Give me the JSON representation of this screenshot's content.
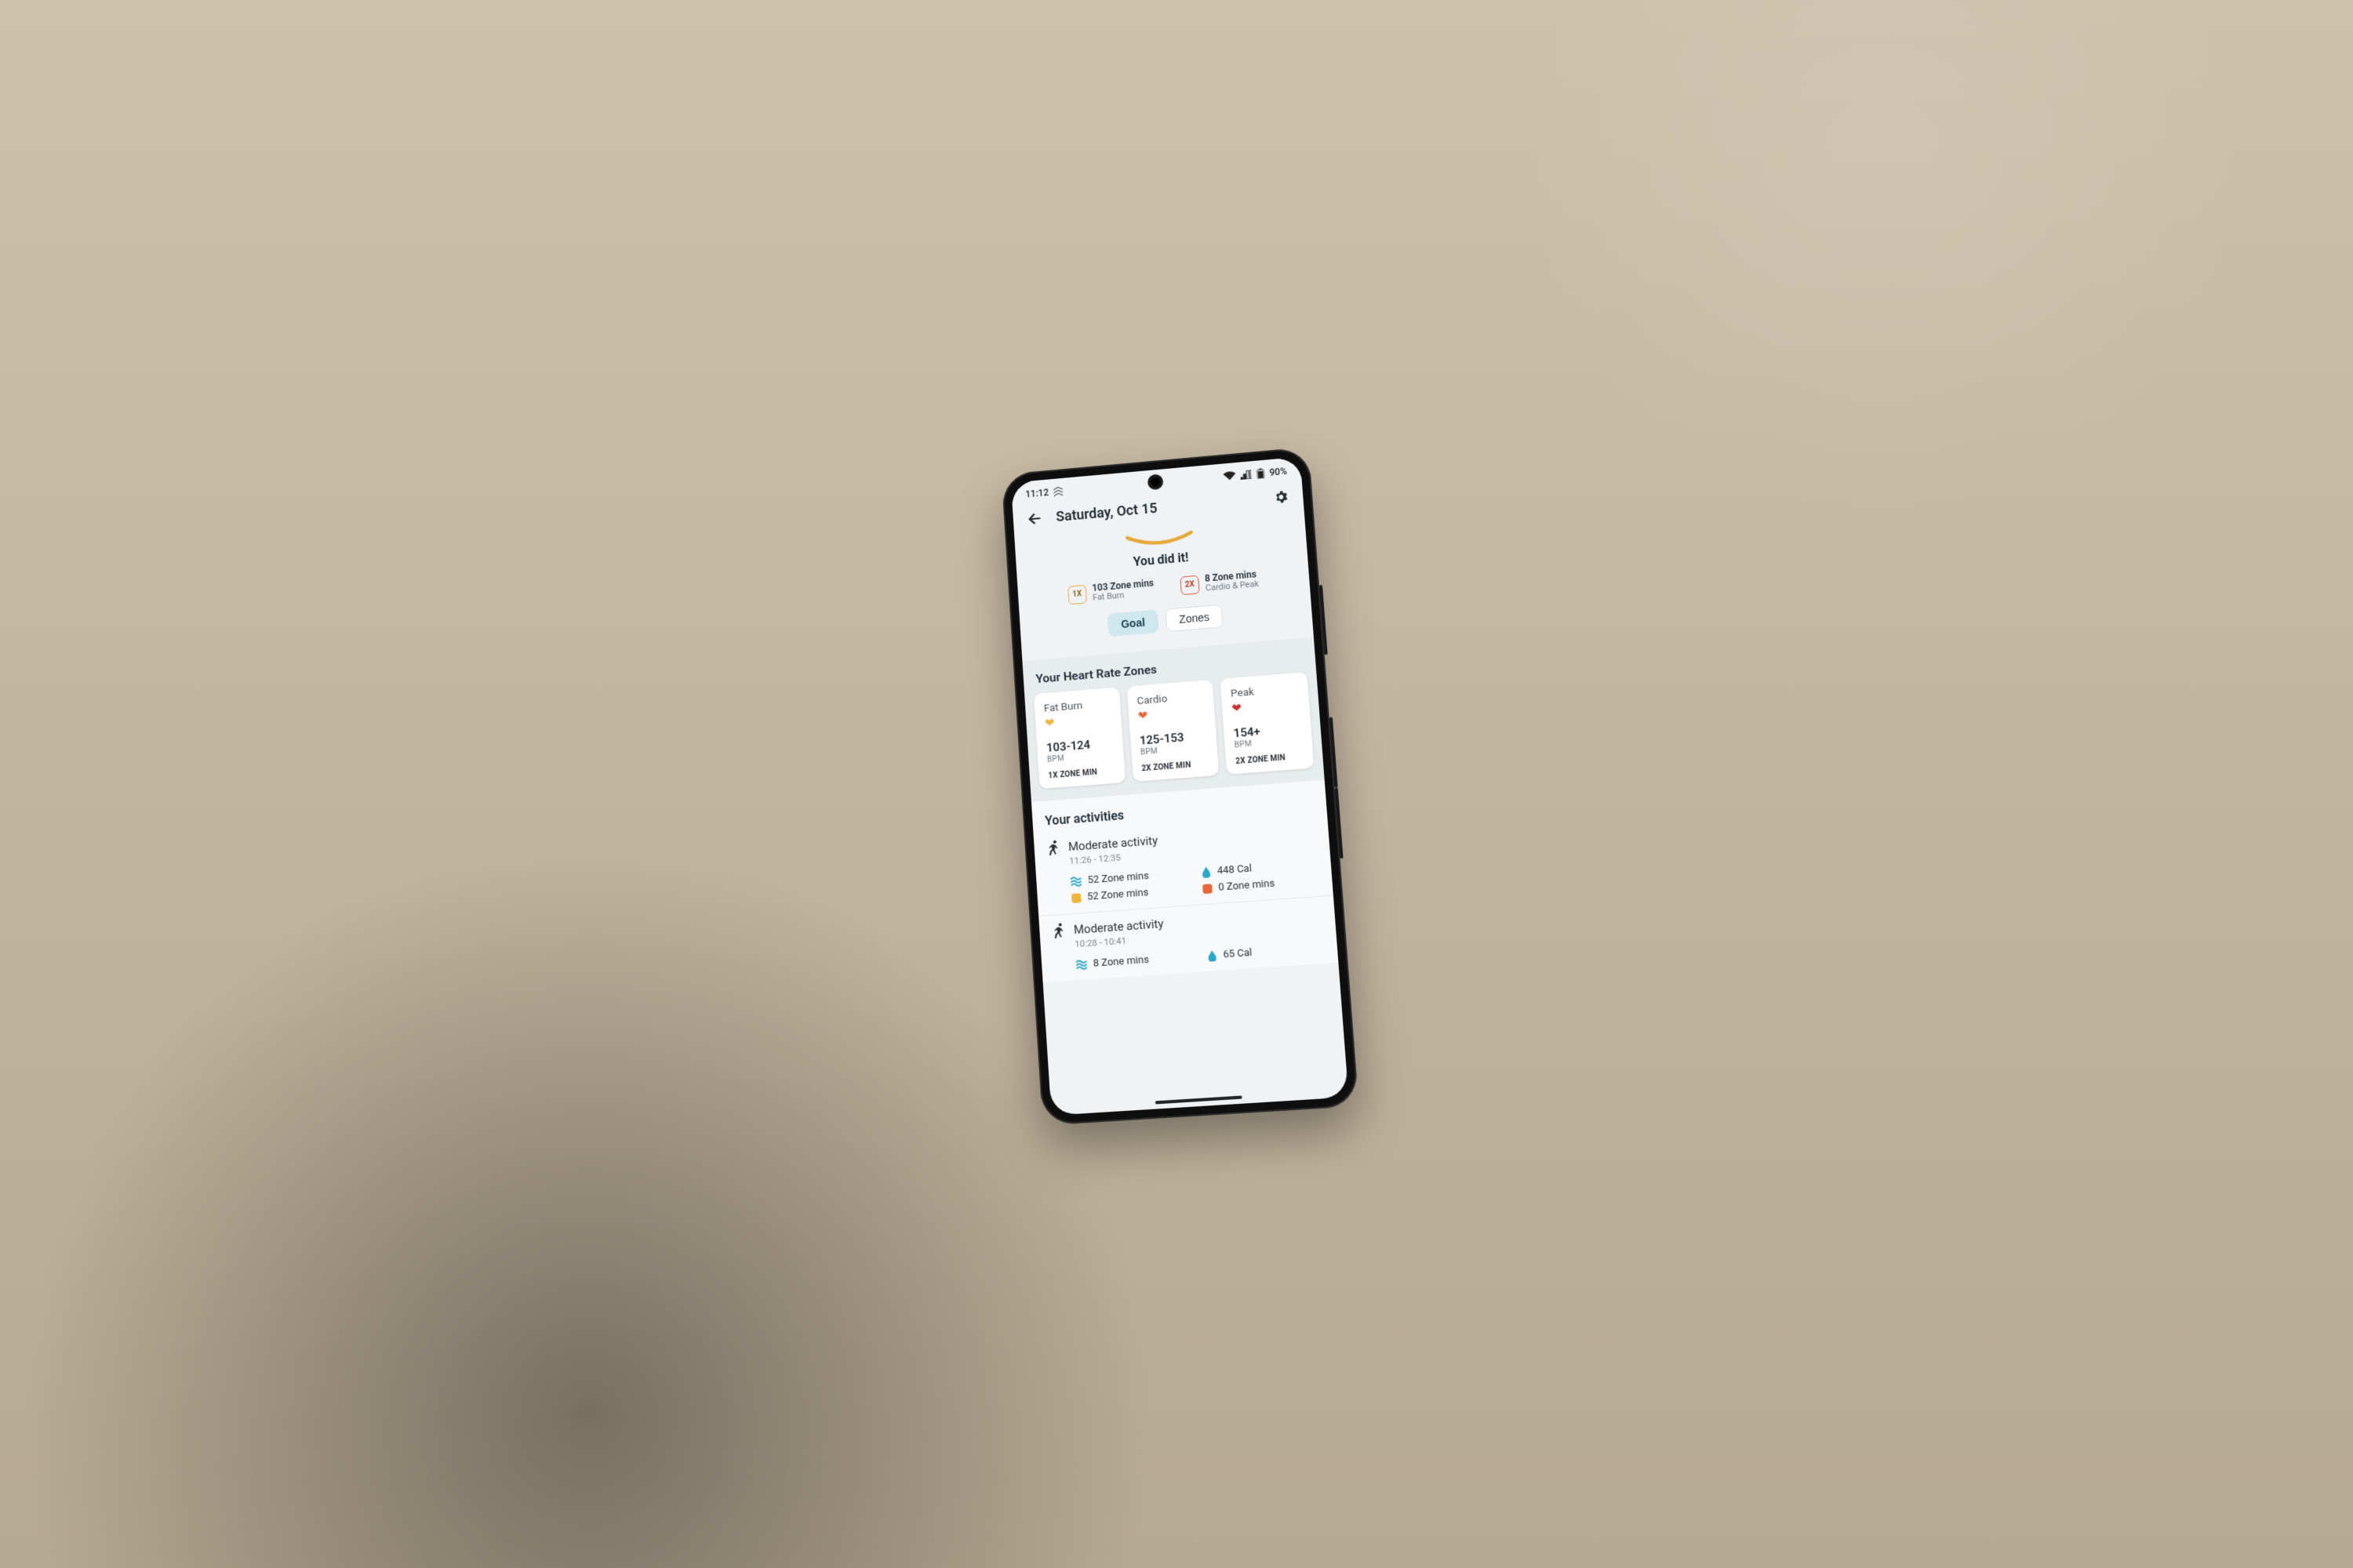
{
  "status": {
    "time": "11:12",
    "carrier_icon": "signal-m-icon",
    "battery_pct": "90%"
  },
  "header": {
    "title": "Saturday, Oct 15"
  },
  "hero": {
    "headline": "You did it!",
    "pills": [
      {
        "multiplier": "1X",
        "line1": "103 Zone mins",
        "line2": "Fat Burn",
        "color": "amber"
      },
      {
        "multiplier": "2X",
        "line1": "8 Zone mins",
        "line2": "Cardio & Peak",
        "color": "red"
      }
    ],
    "tabs": {
      "goal": "Goal",
      "zones": "Zones",
      "active": "goal"
    }
  },
  "zones_section": {
    "heading": "Your Heart Rate Zones",
    "cards": [
      {
        "name": "Fat Burn",
        "heart": "amber",
        "range": "103-124",
        "bpm": "BPM",
        "rule": "1X ZONE MIN"
      },
      {
        "name": "Cardio",
        "heart": "orange",
        "range": "125-153",
        "bpm": "BPM",
        "rule": "2X ZONE MIN"
      },
      {
        "name": "Peak",
        "heart": "red",
        "range": "154+",
        "bpm": "BPM",
        "rule": "2X ZONE MIN"
      }
    ]
  },
  "activities_section": {
    "heading": "Your activities",
    "items": [
      {
        "name": "Moderate activity",
        "time": "11:26 - 12:35",
        "stats": [
          {
            "icon": "waves-icon",
            "text": "52 Zone mins"
          },
          {
            "icon": "drop-icon",
            "text": "448 Cal"
          },
          {
            "icon": "square-amber",
            "text": "52 Zone mins"
          },
          {
            "icon": "square-orange",
            "text": "0 Zone mins"
          }
        ]
      },
      {
        "name": "Moderate activity",
        "time": "10:28 - 10:41",
        "stats": [
          {
            "icon": "waves-icon",
            "text": "8 Zone mins"
          },
          {
            "icon": "drop-icon",
            "text": "65 Cal"
          }
        ]
      }
    ]
  },
  "colors": {
    "amber": "#efb63a",
    "orange": "#e9673d",
    "red": "#c8322e",
    "teal": "#2aa7c8"
  }
}
